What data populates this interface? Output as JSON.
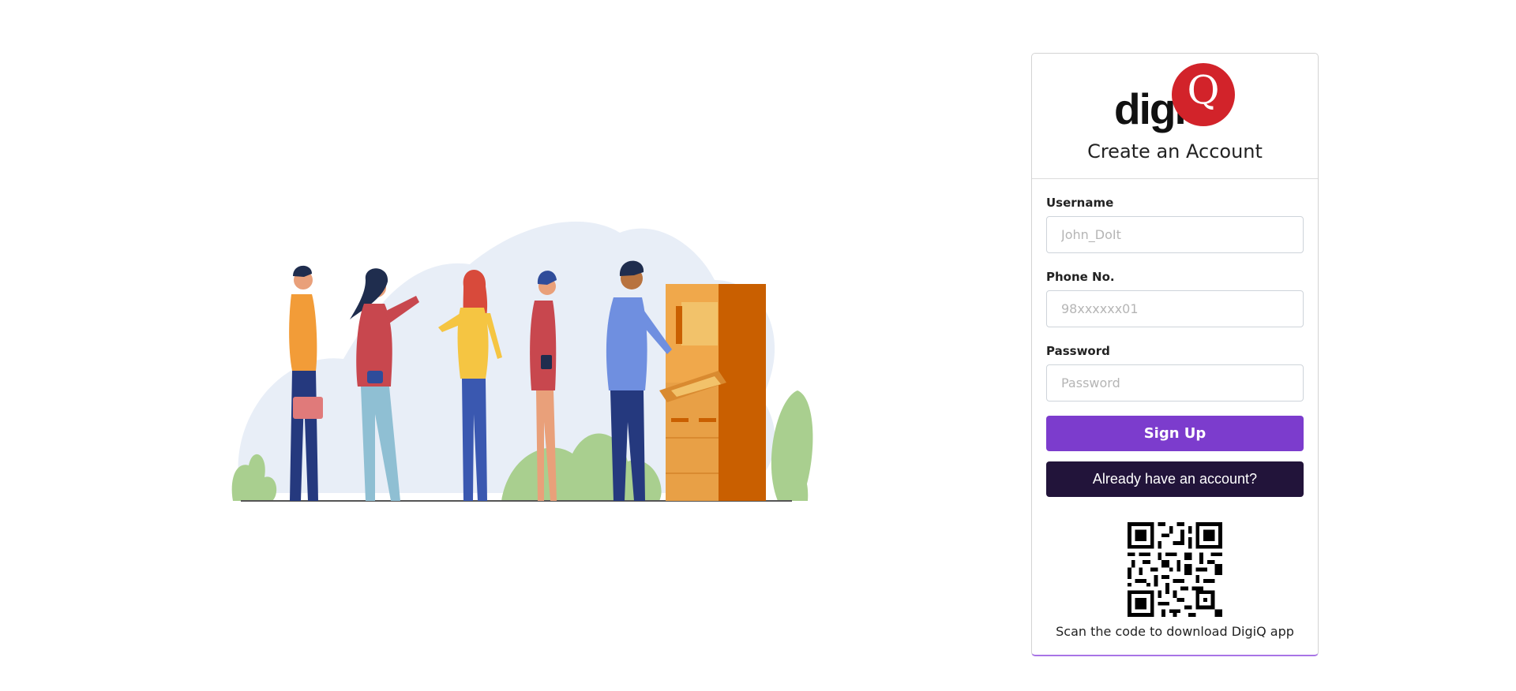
{
  "signup_card": {
    "logo_text": "digi",
    "logo_mark": "Q",
    "title": "Create an Account",
    "username": {
      "label": "Username",
      "placeholder": "John_DoIt",
      "value": ""
    },
    "phone": {
      "label": "Phone No.",
      "placeholder": "98xxxxxx01",
      "value": ""
    },
    "password": {
      "label": "Password",
      "placeholder": "Password",
      "value": ""
    },
    "signup_button": "Sign Up",
    "login_button": "Already have an account?",
    "qr_caption": "Scan the code to download DigiQ app"
  },
  "colors": {
    "brand_red": "#d2232a",
    "signup_purple": "#7c3ccd",
    "login_dark": "#22143a",
    "card_accent": "#a874e6"
  },
  "icons": {
    "hero": "queue-at-kiosk-illustration",
    "qr": "qr-code-icon"
  }
}
